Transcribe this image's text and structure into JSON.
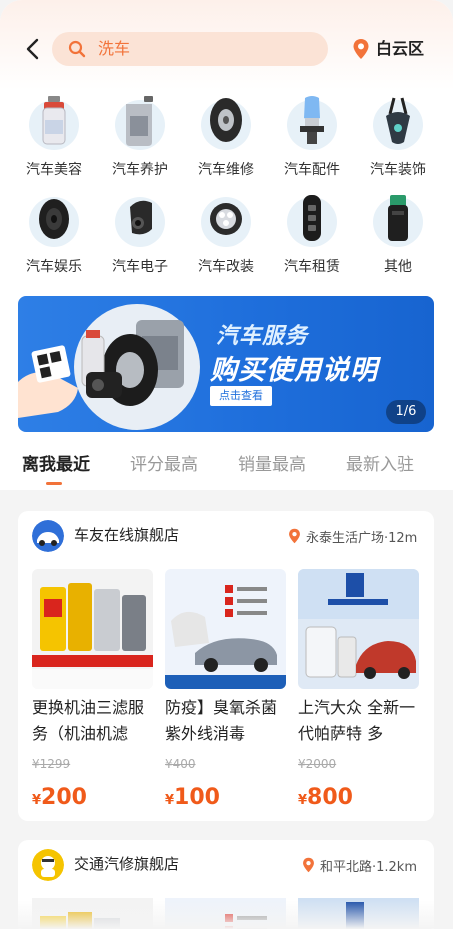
{
  "header": {
    "search_text": "洗车",
    "location": "白云区"
  },
  "categories": [
    {
      "label": "汽车美容",
      "icon": "spray-bottle-icon"
    },
    {
      "label": "汽车养护",
      "icon": "oil-can-icon"
    },
    {
      "label": "汽车维修",
      "icon": "tire-icon"
    },
    {
      "label": "汽车配件",
      "icon": "headlight-bulb-icon"
    },
    {
      "label": "汽车装饰",
      "icon": "air-freshener-icon"
    },
    {
      "label": "汽车娱乐",
      "icon": "speaker-icon"
    },
    {
      "label": "汽车电子",
      "icon": "dashcam-icon"
    },
    {
      "label": "汽车改装",
      "icon": "fog-lamp-icon"
    },
    {
      "label": "汽车租赁",
      "icon": "car-key-icon"
    },
    {
      "label": "其他",
      "icon": "device-icon"
    }
  ],
  "banner": {
    "title_line1": "汽车服务",
    "title_line2": "购买使用说明",
    "button": "点击查看",
    "pager": "1/6"
  },
  "tabs": [
    {
      "label": "离我最近",
      "active": true
    },
    {
      "label": "评分最高",
      "active": false
    },
    {
      "label": "销量最高",
      "active": false
    },
    {
      "label": "最新入驻",
      "active": false
    }
  ],
  "shops": [
    {
      "name": "车友在线旗舰店",
      "location": "永泰生活广场·12m",
      "products": [
        {
          "title": "更换机油三滤服务（机油机滤",
          "original_price": "¥1299",
          "currency": "¥",
          "price": "200"
        },
        {
          "title": "防疫】臭氧杀菌紫外线消毒",
          "original_price": "¥400",
          "currency": "¥",
          "price": "100"
        },
        {
          "title": "上汽大众 全新一代帕萨特 多",
          "original_price": "¥2000",
          "currency": "¥",
          "price": "800"
        }
      ]
    },
    {
      "name": "交通汽修旗舰店",
      "location": "和平北路·1.2km",
      "products": []
    }
  ],
  "colors": {
    "accent": "#f2733a",
    "price": "#f05a1a",
    "banner_blue": "#1f6fdc"
  }
}
